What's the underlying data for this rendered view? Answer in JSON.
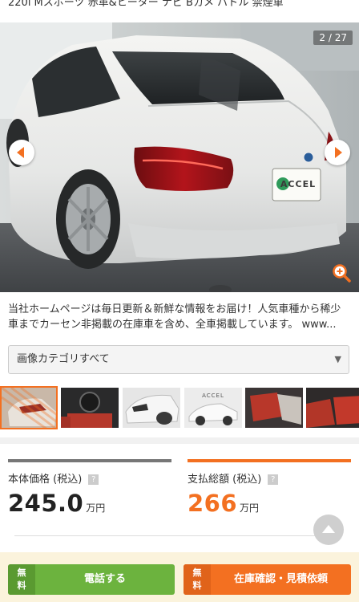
{
  "listing": {
    "title": "220i Mスポーツ 赤革&ヒーター ナビ Bカメ パドル 禁煙車"
  },
  "gallery": {
    "counter": "2 / 27",
    "plate_text": "ACCEL",
    "prev_icon": "left-arrow-icon",
    "next_icon": "right-arrow-icon",
    "zoom_icon": "zoom-in-icon"
  },
  "description": {
    "text": "当社ホームページは毎日更新＆新鮮な情報をお届け！人気車種から稀少車までカーセン非掲載の在庫車を含め、全車掲載しています。 www..."
  },
  "category_select": {
    "value": "画像カテゴリすべて",
    "caret": "▼"
  },
  "thumbnails": {
    "logo_text": "ACCEL"
  },
  "price": {
    "base_label": "本体価格 (税込)",
    "base_value": "245.0",
    "base_unit": "万円",
    "total_label": "支払総額 (税込)",
    "total_value": "266",
    "total_unit": "万円",
    "help_glyph": "?"
  },
  "cta": {
    "free_label": "無料",
    "phone_label": "電話する",
    "stock_label": "在庫確認・見積依頼"
  },
  "colors": {
    "accent_orange": "#f37021",
    "cta_green": "#6cb33e",
    "band_cream": "#fbf3dc"
  }
}
